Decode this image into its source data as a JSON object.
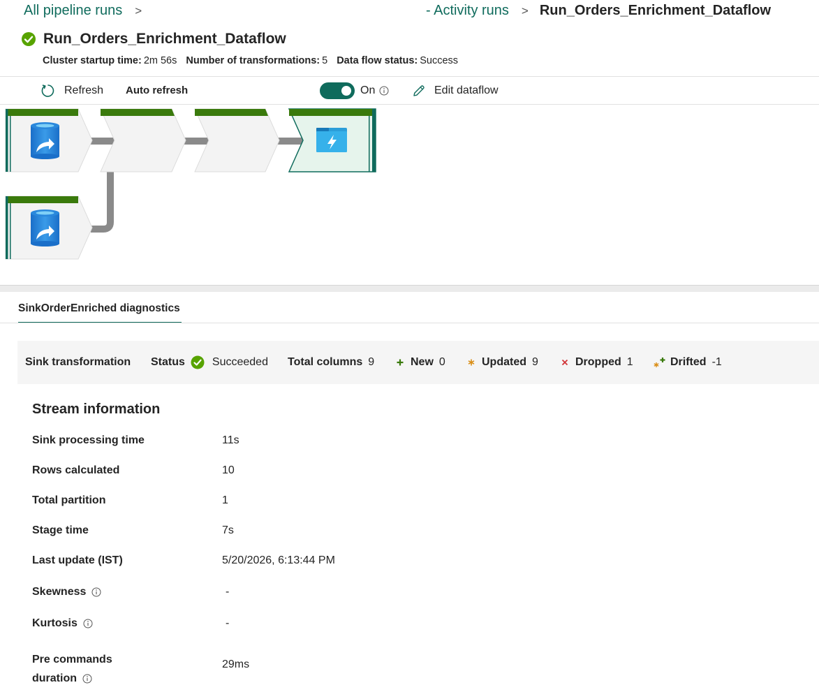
{
  "breadcrumb": {
    "root": "All pipeline runs",
    "separator": ">",
    "activity": "- Activity runs",
    "current": "Run_Orders_Enrichment_Dataflow"
  },
  "header": {
    "title": "Run_Orders_Enrichment_Dataflow",
    "status_icon": "success-check-icon",
    "meta": [
      {
        "label": "Cluster startup time:",
        "value": "2m 56s"
      },
      {
        "label": "Number of transformations:",
        "value": "5"
      },
      {
        "label": "Data flow status:",
        "value": "Success"
      }
    ]
  },
  "toolbar": {
    "refresh_label": "Refresh",
    "auto_refresh_label": "Auto refresh",
    "toggle_state": "On",
    "edit_label": "Edit dataflow"
  },
  "graph": {
    "nodes": [
      {
        "kind": "source",
        "icon": "database-source-icon"
      },
      {
        "kind": "transform",
        "icon": ""
      },
      {
        "kind": "transform",
        "icon": ""
      },
      {
        "kind": "sink",
        "icon": "storage-folder-icon",
        "selected": true
      },
      {
        "kind": "source",
        "icon": "database-source-icon"
      }
    ]
  },
  "diagnostics": {
    "tab_label": "SinkOrderEnriched diagnostics",
    "summary": {
      "transformation": "Sink transformation",
      "status_label": "Status",
      "status_value": "Succeeded",
      "total_columns_label": "Total columns",
      "total_columns_value": "9",
      "new_label": "New",
      "new_value": "0",
      "updated_label": "Updated",
      "updated_value": "9",
      "dropped_label": "Dropped",
      "dropped_value": "1",
      "drifted_label": "Drifted",
      "drifted_value": "-1"
    },
    "stream_title": "Stream information",
    "stream": [
      {
        "label": "Sink processing time",
        "value": "11s"
      },
      {
        "label": "Rows calculated",
        "value": "10"
      },
      {
        "label": "Total partition",
        "value": "1"
      },
      {
        "label": "Stage time",
        "value": "7s"
      },
      {
        "label": "Last update (IST)",
        "value": "5/20/2026, 6:13:44 PM"
      },
      {
        "label": "Skewness",
        "value": "-"
      },
      {
        "label": "Kurtosis",
        "value": "-"
      },
      {
        "label": "Pre commands",
        "label2": "duration",
        "value": "29ms"
      }
    ]
  },
  "colors": {
    "accent": "#0f6b5c",
    "node_topbar": "#3a7a0c",
    "success": "#57a300",
    "link": "#0f6b5c"
  }
}
